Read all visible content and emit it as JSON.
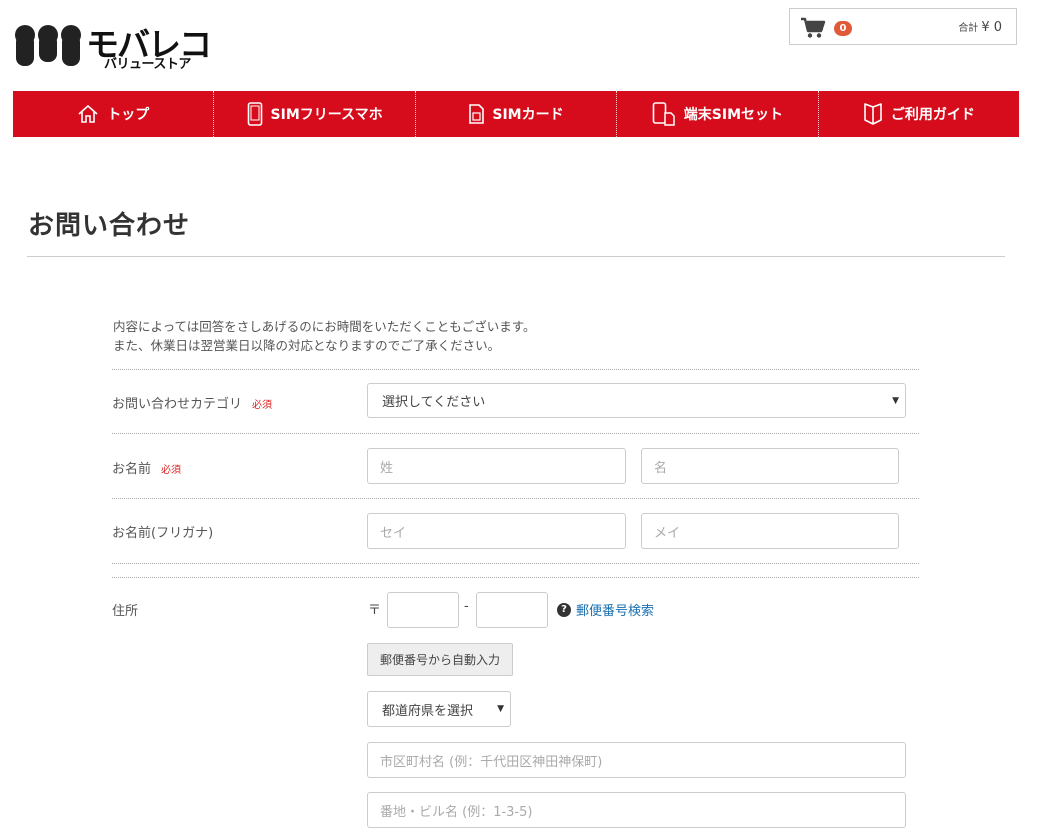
{
  "header": {
    "logo_text": "モバレコ",
    "logo_sub": "バリューストア",
    "cart_count": "0",
    "cart_total_label": "合計",
    "cart_total_value": "¥ 0"
  },
  "nav": [
    {
      "label": "トップ",
      "icon": "home-icon"
    },
    {
      "label": "SIMフリースマホ",
      "icon": "smartphone-icon"
    },
    {
      "label": "SIMカード",
      "icon": "sim-card-icon"
    },
    {
      "label": "端末SIMセット",
      "icon": "device-sim-set-icon"
    },
    {
      "label": "ご利用ガイド",
      "icon": "guide-book-icon"
    }
  ],
  "page": {
    "title": "お問い合わせ",
    "intro_line1": "内容によっては回答をさしあげるのにお時間をいただくこともございます。",
    "intro_line2": "また、休業日は翌営業日以降の対応となりますのでご了承ください。"
  },
  "form": {
    "required_mark": "必須",
    "category": {
      "label": "お問い合わせカテゴリ",
      "value": "選択してください"
    },
    "name": {
      "label": "お名前",
      "last_placeholder": "姓",
      "first_placeholder": "名"
    },
    "kana": {
      "label": "お名前(フリガナ)",
      "last_placeholder": "セイ",
      "first_placeholder": "メイ"
    },
    "address": {
      "label": "住所",
      "postal_mark": "〒",
      "postal_sep": "-",
      "zip_search_link": "郵便番号検索",
      "auto_fill_button": "郵便番号から自動入力",
      "prefecture_value": "都道府県を選択",
      "city_placeholder": "市区町村名 (例：千代田区神田神保町)",
      "street_placeholder": "番地・ビル名 (例：1-3-5)"
    }
  },
  "colors": {
    "nav_bg": "#d60c1c",
    "required": "#dd2222",
    "link": "#1a6fb0"
  }
}
